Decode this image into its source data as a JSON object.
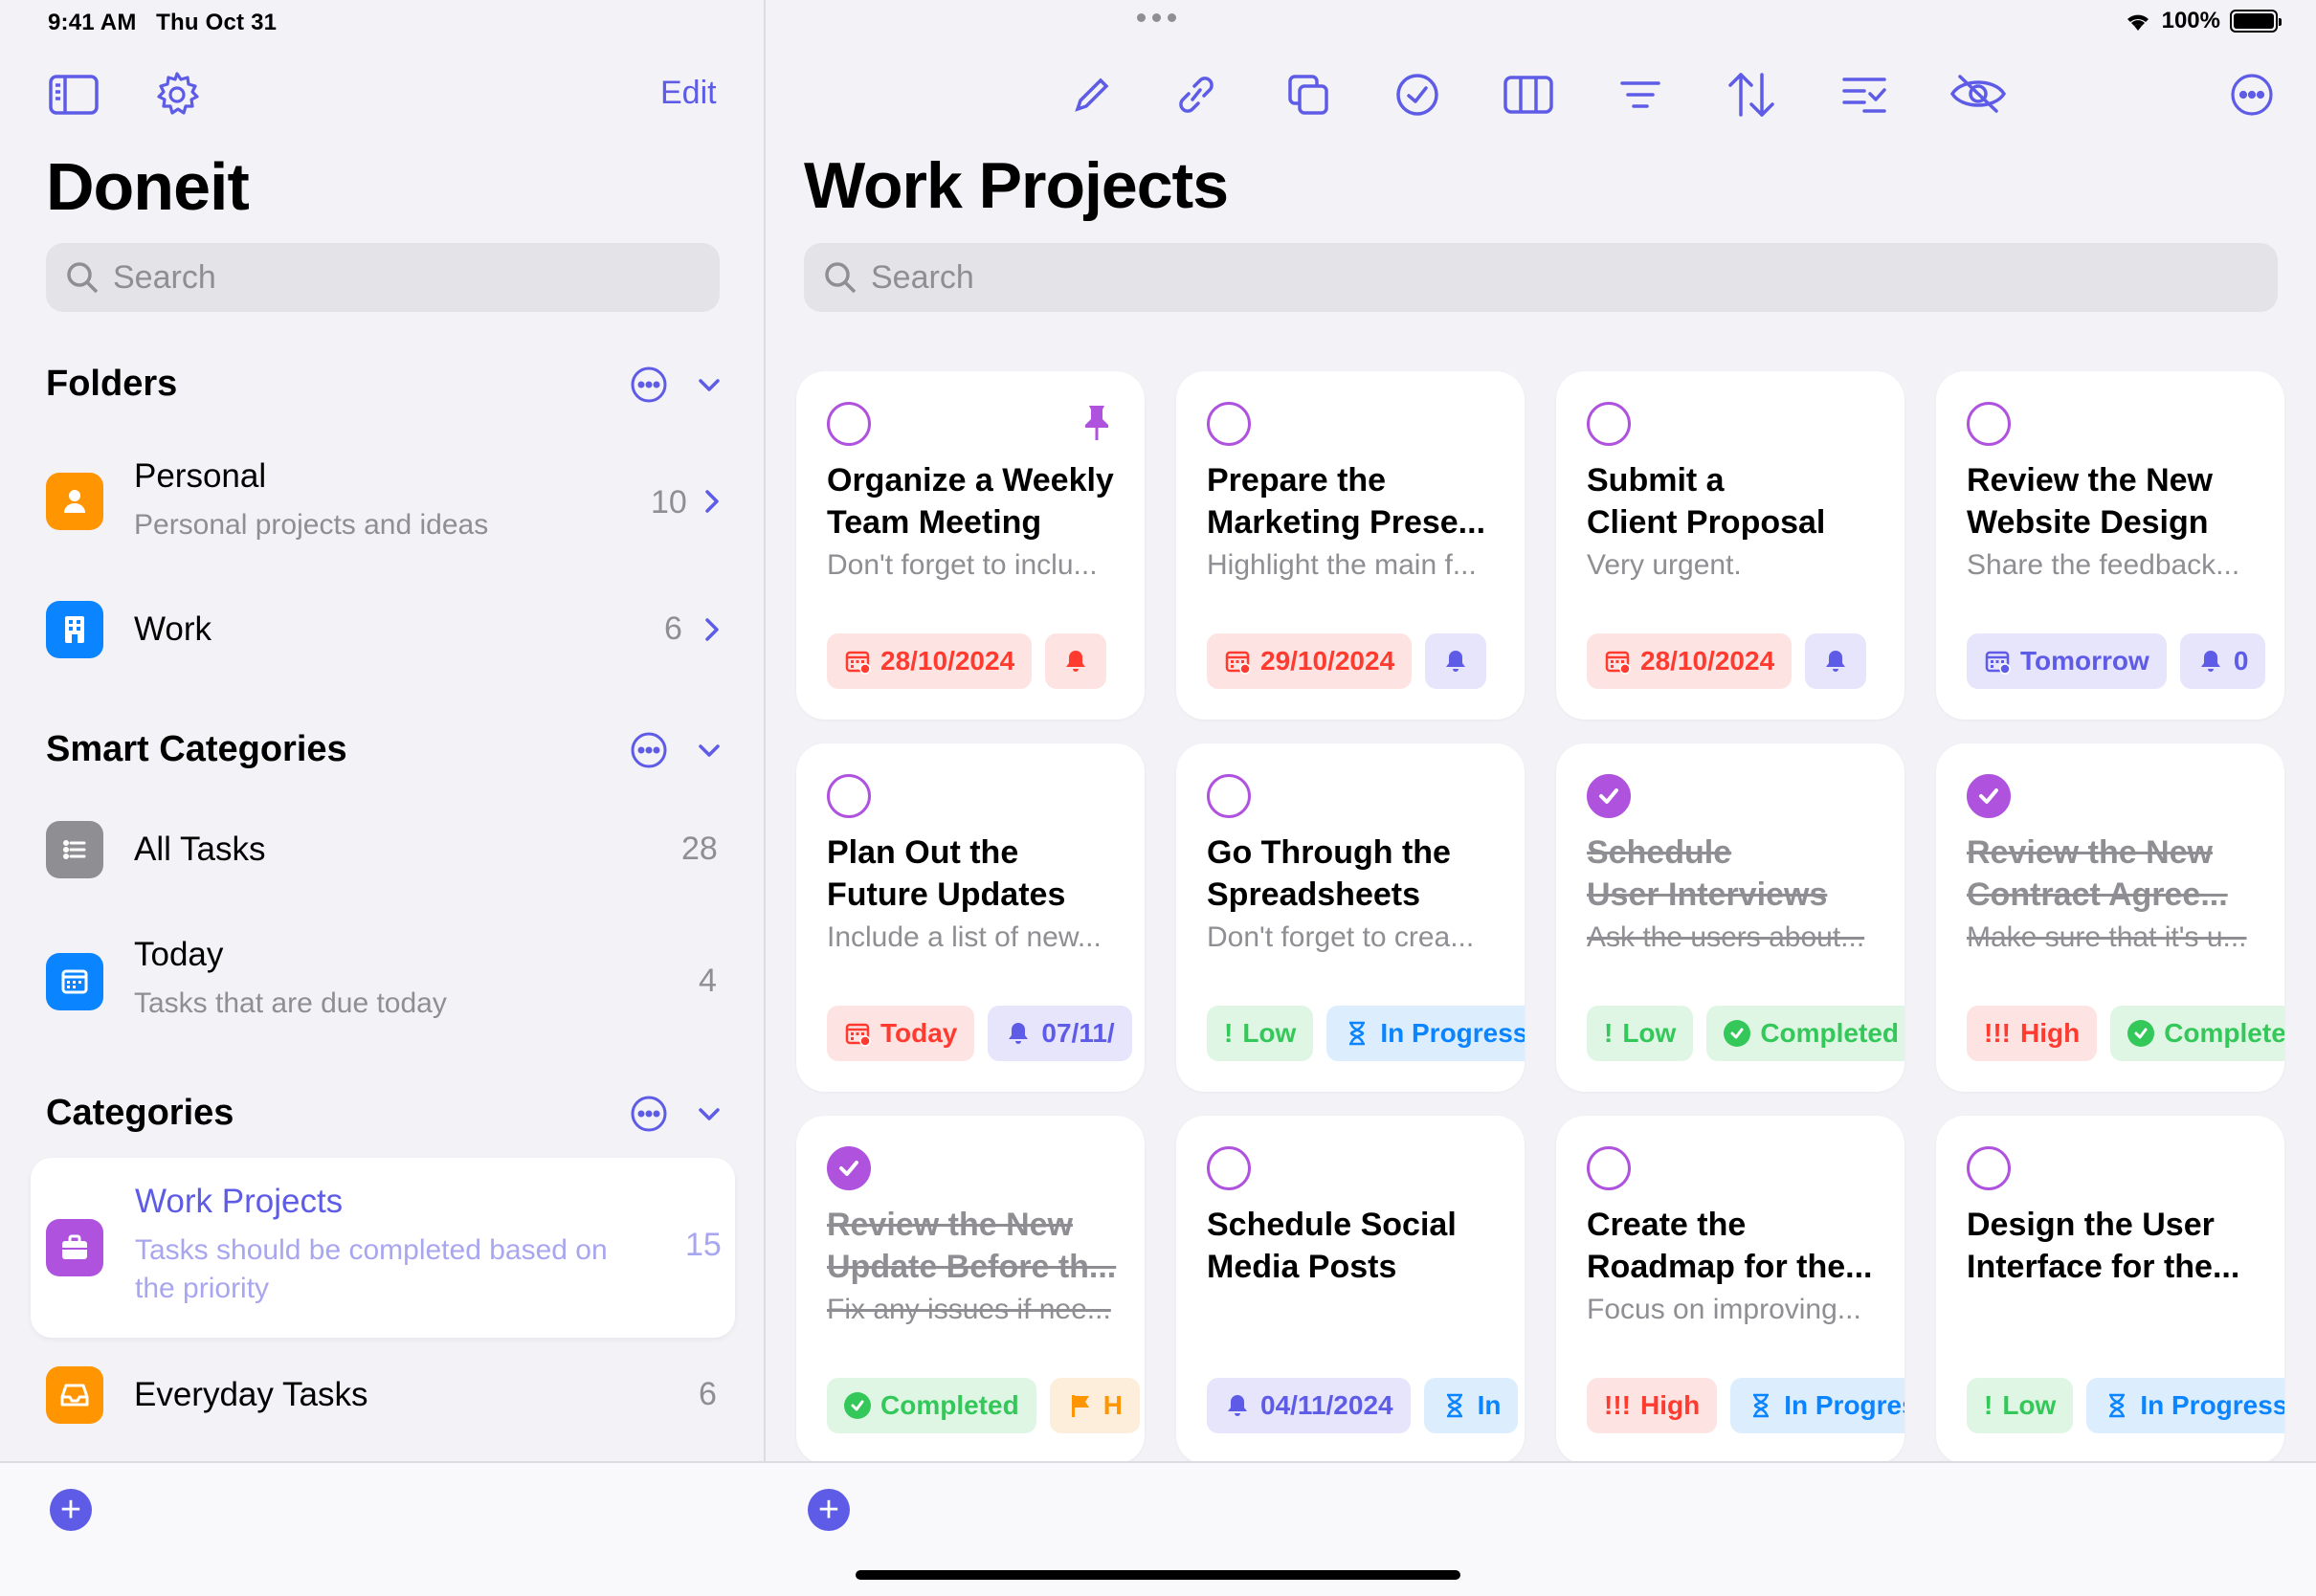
{
  "status": {
    "time": "9:41 AM",
    "date": "Thu Oct 31",
    "battery": "100%"
  },
  "sidebar": {
    "edit_label": "Edit",
    "app_title": "Doneit",
    "search_placeholder": "Search",
    "folders_heading": "Folders",
    "folders": [
      {
        "title": "Personal",
        "subtitle": "Personal projects and ideas",
        "count": "10",
        "color": "#ff9500",
        "icon": "person-icon"
      },
      {
        "title": "Work",
        "subtitle": "",
        "count": "6",
        "color": "#0a84ff",
        "icon": "building-icon"
      }
    ],
    "smart_heading": "Smart Categories",
    "smart": [
      {
        "title": "All Tasks",
        "subtitle": "",
        "count": "28",
        "color": "#8e8e93",
        "icon": "list-icon"
      },
      {
        "title": "Today",
        "subtitle": "Tasks that are due today",
        "count": "4",
        "color": "#0a84ff",
        "icon": "calendar-icon"
      }
    ],
    "categories_heading": "Categories",
    "categories": [
      {
        "title": "Work Projects",
        "subtitle_line1": "Tasks should be completed based on",
        "subtitle_line2": "the priority",
        "count": "15",
        "color": "#af52de",
        "icon": "briefcase-icon"
      },
      {
        "title": "Everyday Tasks",
        "subtitle": "",
        "count": "6",
        "color": "#ff9500",
        "icon": "tray-icon"
      }
    ]
  },
  "main": {
    "title": "Work Projects",
    "search_placeholder": "Search",
    "cards": [
      {
        "title1": "Organize a Weekly",
        "title2": "Team Meeting",
        "note": "Don't forget to inclu...",
        "done": false,
        "pinned": true,
        "tags": [
          {
            "style": "red",
            "icon": "calendar-icon",
            "text": "28/10/2024"
          },
          {
            "style": "red",
            "icon": "bell-icon",
            "text": ""
          }
        ]
      },
      {
        "title1": "Prepare the",
        "title2": "Marketing Prese...",
        "note": "Highlight the main f...",
        "done": false,
        "tags": [
          {
            "style": "red",
            "icon": "calendar-icon",
            "text": "29/10/2024"
          },
          {
            "style": "purple",
            "icon": "bell-icon",
            "text": ""
          }
        ]
      },
      {
        "title1": "Submit a",
        "title2": "Client Proposal",
        "note": "Very urgent.",
        "done": false,
        "tags": [
          {
            "style": "red",
            "icon": "calendar-icon",
            "text": "28/10/2024"
          },
          {
            "style": "purple",
            "icon": "bell-icon",
            "text": ""
          }
        ]
      },
      {
        "title1": "Review the New",
        "title2": "Website Design",
        "note": "Share the feedback...",
        "done": false,
        "tags": [
          {
            "style": "purple",
            "icon": "calendar-icon",
            "text": "Tomorrow"
          },
          {
            "style": "purple",
            "icon": "bell-icon",
            "text": "0"
          }
        ]
      },
      {
        "title1": "Plan Out the",
        "title2": "Future Updates",
        "note": "Include a list of new...",
        "done": false,
        "tags": [
          {
            "style": "red",
            "icon": "calendar-icon",
            "text": "Today"
          },
          {
            "style": "purple",
            "icon": "bell-icon",
            "text": "07/11/"
          }
        ]
      },
      {
        "title1": "Go Through the",
        "title2": "Spreadsheets",
        "note": "Don't forget to crea...",
        "done": false,
        "tags": [
          {
            "style": "green",
            "icon": "exclaim",
            "text": "Low"
          },
          {
            "style": "blue",
            "icon": "hourglass-icon",
            "text": "In Progress"
          }
        ]
      },
      {
        "title1": "Schedule",
        "title2": "User Interviews",
        "note": "Ask the users about...",
        "done": true,
        "tags": [
          {
            "style": "green",
            "icon": "exclaim",
            "text": "Low"
          },
          {
            "style": "green",
            "icon": "check-circle-icon",
            "text": "Completed"
          }
        ]
      },
      {
        "title1": "Review the New",
        "title2": "Contract Agree...",
        "note": "Make sure that it's u...",
        "done": true,
        "tags": [
          {
            "style": "red",
            "icon": "exclaim3",
            "text": "High"
          },
          {
            "style": "green",
            "icon": "check-circle-icon",
            "text": "Completed"
          }
        ]
      },
      {
        "title1": "Review the New",
        "title2": "Update Before th...",
        "note": "Fix any issues if nee...",
        "done": true,
        "tags": [
          {
            "style": "green",
            "icon": "check-circle-icon",
            "text": "Completed"
          },
          {
            "style": "orange",
            "icon": "flag-icon",
            "text": "H"
          }
        ]
      },
      {
        "title1": "Schedule Social",
        "title2": "Media Posts",
        "note": "",
        "done": false,
        "tags": [
          {
            "style": "purple",
            "icon": "bell-icon",
            "text": "04/11/2024"
          },
          {
            "style": "blue",
            "icon": "hourglass-icon",
            "text": "In"
          }
        ]
      },
      {
        "title1": "Create the",
        "title2": "Roadmap for the...",
        "note": "Focus on improving...",
        "done": false,
        "tags": [
          {
            "style": "red",
            "icon": "exclaim3",
            "text": "High"
          },
          {
            "style": "blue",
            "icon": "hourglass-icon",
            "text": "In Progress"
          }
        ]
      },
      {
        "title1": "Design the User",
        "title2": "Interface for the...",
        "note": "",
        "done": false,
        "tags": [
          {
            "style": "green",
            "icon": "exclaim",
            "text": "Low"
          },
          {
            "style": "blue",
            "icon": "hourglass-icon",
            "text": "In Progress"
          }
        ]
      }
    ]
  },
  "colors": {
    "accent": "#5e5ce6",
    "purple": "#af52de"
  }
}
